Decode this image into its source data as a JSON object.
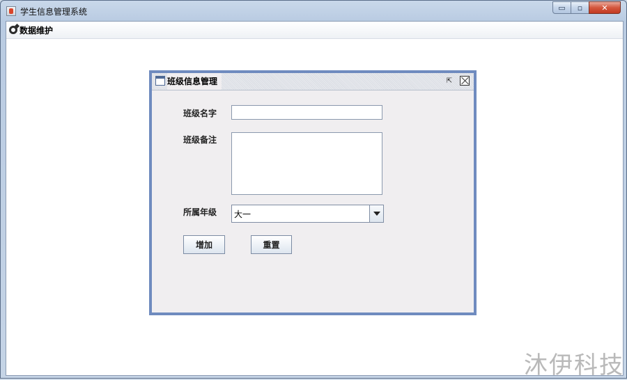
{
  "window": {
    "title": "学生信息管理系统",
    "controls": {
      "minimize": "▭",
      "maximize": "▫",
      "close": "✕"
    }
  },
  "menubar": {
    "items": [
      {
        "label": "数据维护",
        "icon": "gear-icon"
      }
    ]
  },
  "internal_frame": {
    "title": "班级信息管理",
    "restore_glyph": "⇱"
  },
  "form": {
    "class_name_label": "班级名字",
    "class_name_value": "",
    "class_note_label": "班级备注",
    "class_note_value": "",
    "grade_label": "所属年级",
    "grade_selected": "大一",
    "add_button": "增加",
    "reset_button": "重置"
  },
  "watermark": "沐伊科技",
  "colors": {
    "frame_border": "#6f8bbf",
    "frame_background": "#f0eef0",
    "close_button": "#c23a22"
  }
}
